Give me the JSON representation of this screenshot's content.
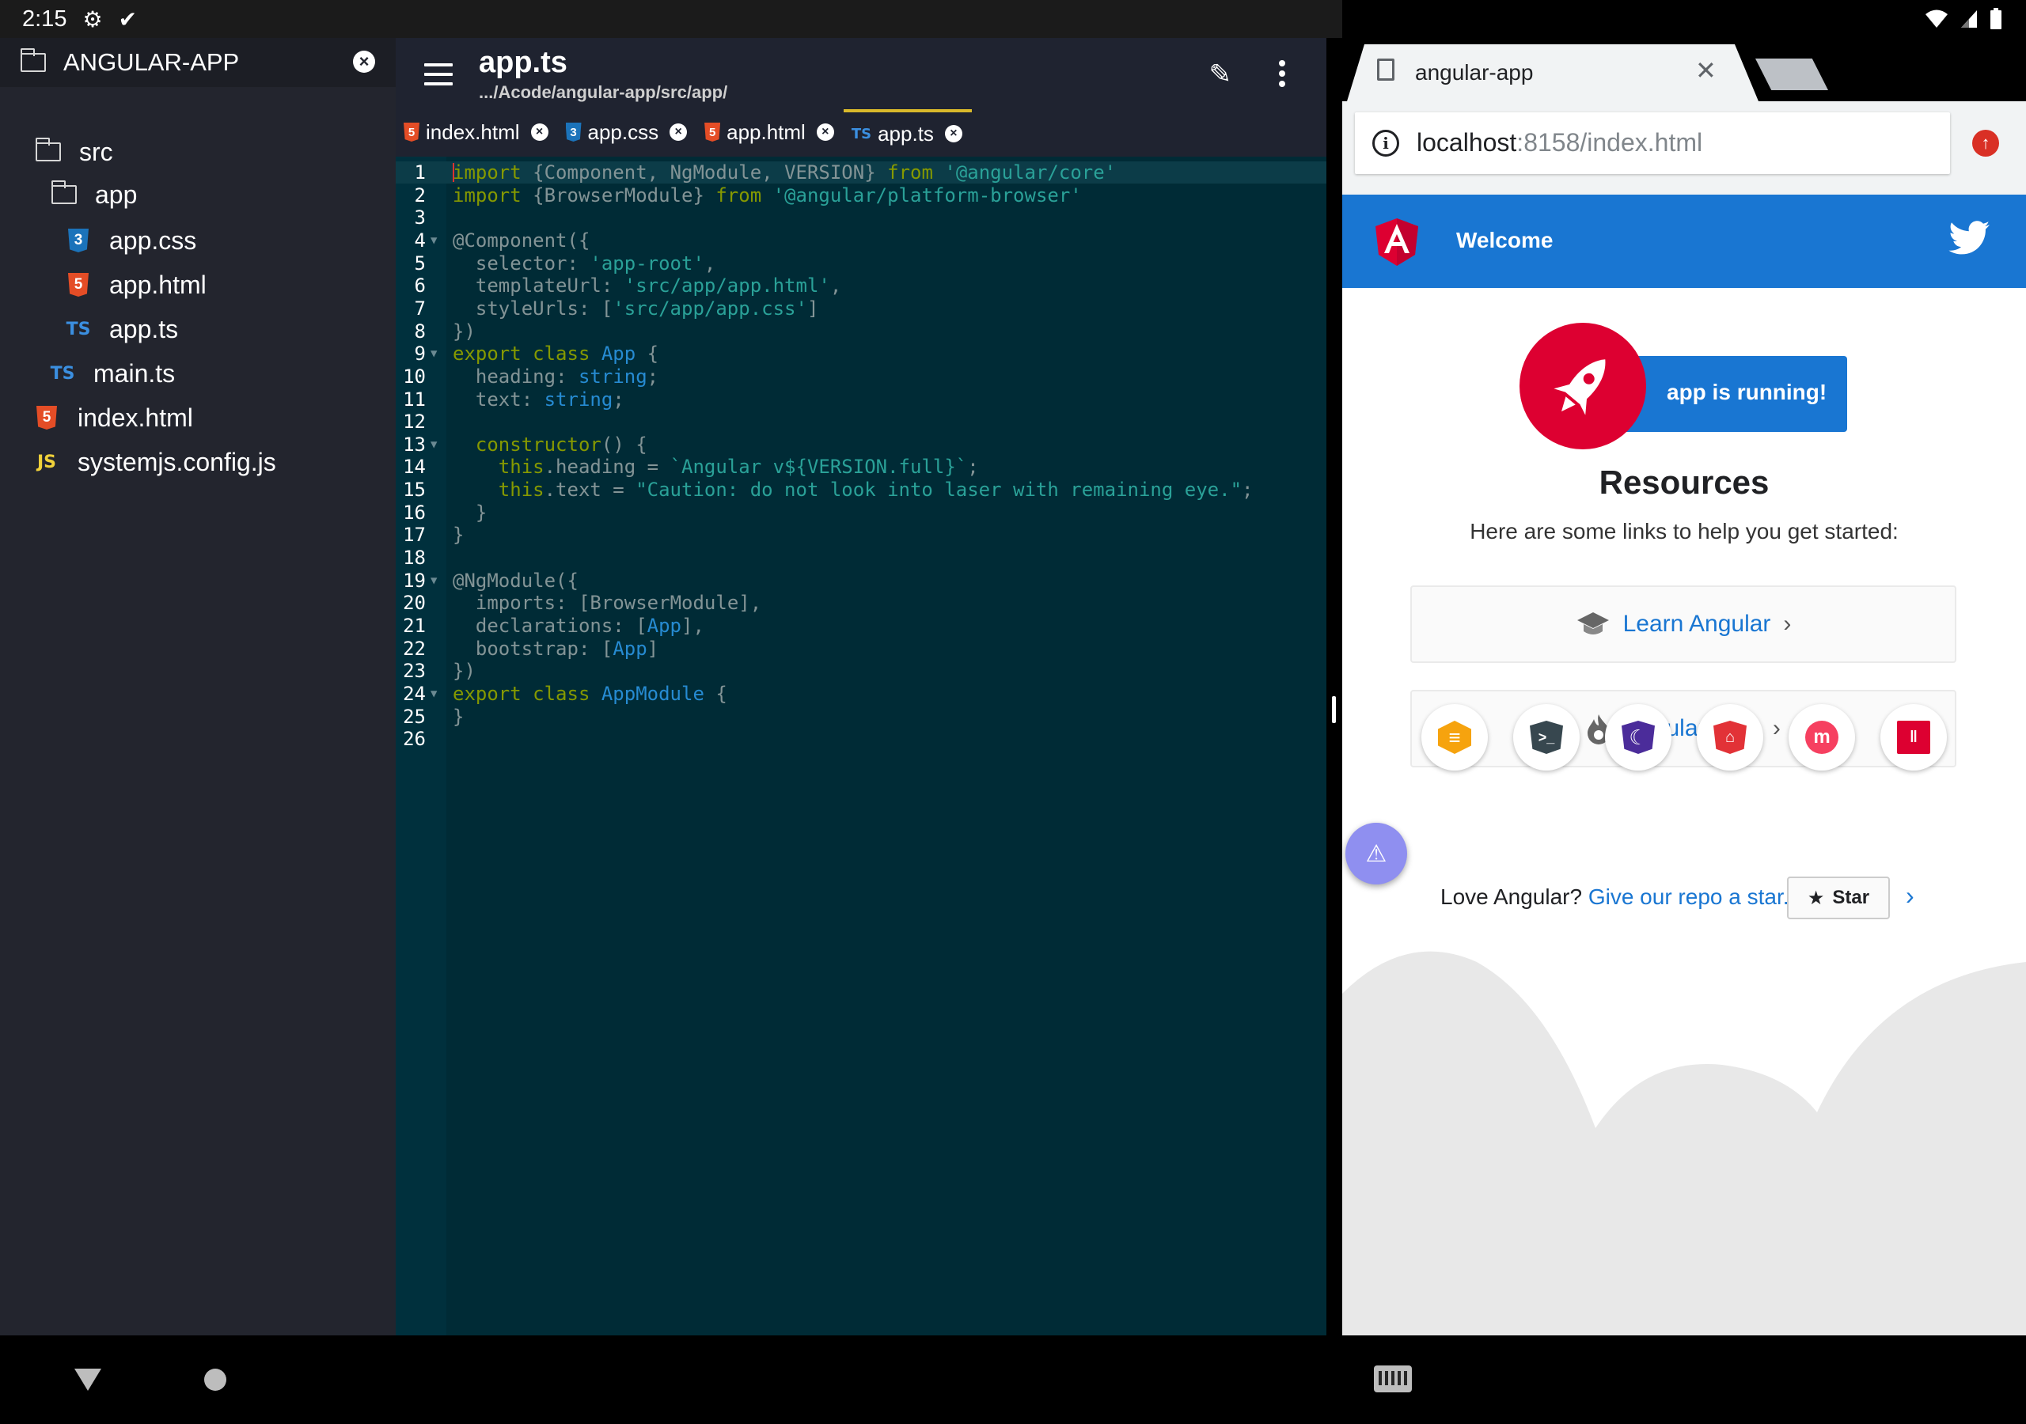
{
  "status_bar": {
    "time": "2:15",
    "icons": [
      "settings-icon",
      "checkmark-icon",
      "wifi-icon",
      "signal-icon",
      "battery-icon"
    ]
  },
  "editor": {
    "sidebar": {
      "root_label": "ANGULAR-APP",
      "items": [
        {
          "label": "src",
          "type": "folder"
        },
        {
          "label": "app",
          "type": "folder"
        },
        {
          "label": "app.css",
          "type": "css"
        },
        {
          "label": "app.html",
          "type": "html"
        },
        {
          "label": "app.ts",
          "type": "ts"
        },
        {
          "label": "main.ts",
          "type": "ts"
        },
        {
          "label": "index.html",
          "type": "html"
        },
        {
          "label": "systemjs.config.js",
          "type": "js"
        }
      ]
    },
    "header": {
      "file_name": "app.ts",
      "file_path": ".../Acode/angular-app/src/app/"
    },
    "tabs": [
      {
        "label": "index.html",
        "type": "html",
        "active": false
      },
      {
        "label": "app.css",
        "type": "css",
        "active": false
      },
      {
        "label": "app.html",
        "type": "html",
        "active": false
      },
      {
        "label": "app.ts",
        "type": "ts",
        "active": true
      }
    ],
    "badge_text": {
      "html": "5",
      "css": "3",
      "ts": "TS",
      "js": "JS"
    },
    "code_lines": [
      "import {Component, NgModule, VERSION} from '@angular/core'",
      "import {BrowserModule} from '@angular/platform-browser'",
      "",
      "@Component({",
      "  selector: 'app-root',",
      "  templateUrl: 'src/app/app.html',",
      "  styleUrls: ['src/app/app.css']",
      "})",
      "export class App {",
      "  heading: string;",
      "  text: string;",
      "",
      "  constructor() {",
      "    this.heading = `Angular v${VERSION.full}`;",
      "    this.text = \"Caution: do not look into laser with remaining eye.\";",
      "  }",
      "}",
      "",
      "@NgModule({",
      "  imports: [BrowserModule],",
      "  declarations: [App],",
      "  bootstrap: [App]",
      "})",
      "export class AppModule {",
      "}",
      ""
    ],
    "fold_lines": [
      4,
      9,
      13,
      19,
      24
    ],
    "theme_colors": {
      "background": "#002b36",
      "keyword": "#859900",
      "string": "#2aa198",
      "type": "#268bd2",
      "active_tab": "#d9b92b"
    }
  },
  "browser": {
    "tab_title": "angular-app",
    "url_host": "localhost",
    "url_rest": ":8158/index.html",
    "page": {
      "toolbar_title": "Welcome",
      "running_label": "app is running!",
      "resources_heading": "Resources",
      "resources_subheading": "Here are some links to help you get started:",
      "cards": [
        {
          "label": "Learn Angular",
          "icon": "graduation-cap-icon"
        },
        {
          "label": "Angular Blog",
          "icon": "flame-icon"
        }
      ],
      "ecosystem_icons": [
        "animations-icon",
        "cli-icon",
        "augury-icon",
        "protractor-icon",
        "meetup-icon",
        "discord-icon"
      ],
      "love_prefix": "Love Angular?",
      "love_link": "Give our repo a star.",
      "star_label": "Star",
      "colors": {
        "brand_blue": "#1976d2",
        "angular_red": "#dd0031"
      }
    }
  }
}
